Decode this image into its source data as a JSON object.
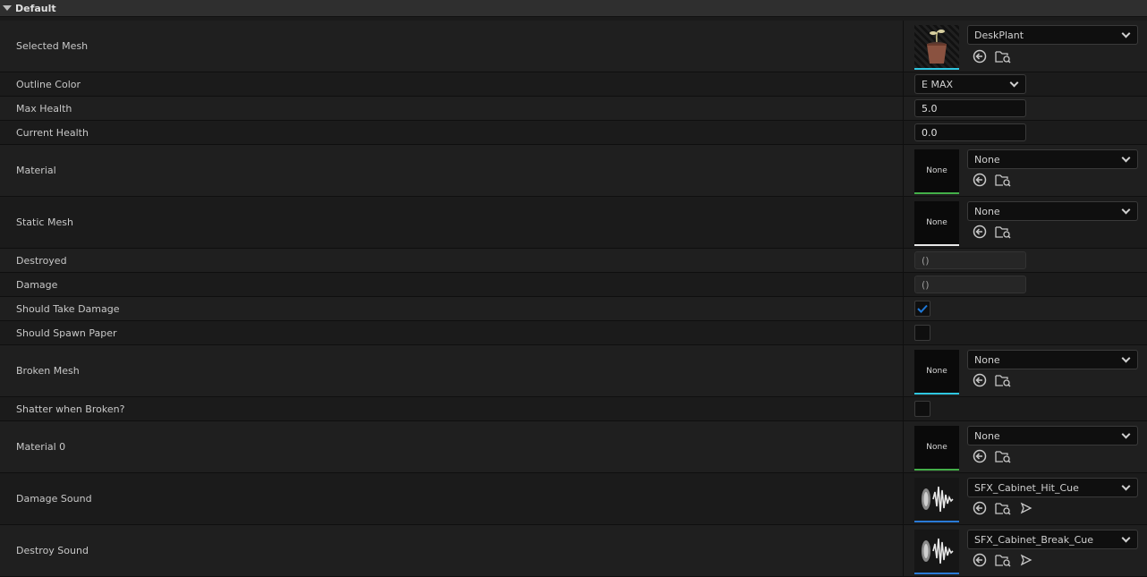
{
  "section": {
    "title": "Default"
  },
  "rows": {
    "selected_mesh": {
      "label": "Selected Mesh",
      "value": "DeskPlant"
    },
    "outline_color": {
      "label": "Outline Color",
      "value": "E MAX"
    },
    "max_health": {
      "label": "Max Health",
      "value": "5.0"
    },
    "current_health": {
      "label": "Current Health",
      "value": "0.0"
    },
    "material": {
      "label": "Material",
      "value": "None",
      "thumb": "None"
    },
    "static_mesh": {
      "label": "Static Mesh",
      "value": "None",
      "thumb": "None"
    },
    "destroyed": {
      "label": "Destroyed",
      "value": "()"
    },
    "damage": {
      "label": "Damage",
      "value": "()"
    },
    "should_take_damage": {
      "label": "Should Take Damage",
      "checked": true
    },
    "should_spawn_paper": {
      "label": "Should Spawn Paper",
      "checked": false
    },
    "broken_mesh": {
      "label": "Broken Mesh",
      "value": "None",
      "thumb": "None"
    },
    "shatter_when_broken": {
      "label": "Shatter when Broken?",
      "checked": false
    },
    "material_0": {
      "label": "Material 0",
      "value": "None",
      "thumb": "None"
    },
    "damage_sound": {
      "label": "Damage Sound",
      "value": "SFX_Cabinet_Hit_Cue"
    },
    "destroy_sound": {
      "label": "Destroy Sound",
      "value": "SFX_Cabinet_Break_Cue"
    }
  },
  "icons": {
    "use_selected": "use-selected-asset-icon",
    "browse": "browse-asset-icon",
    "play": "play-sound-icon",
    "expand": "collapse-triangle-icon",
    "dropdown": "chevron-down-icon"
  }
}
